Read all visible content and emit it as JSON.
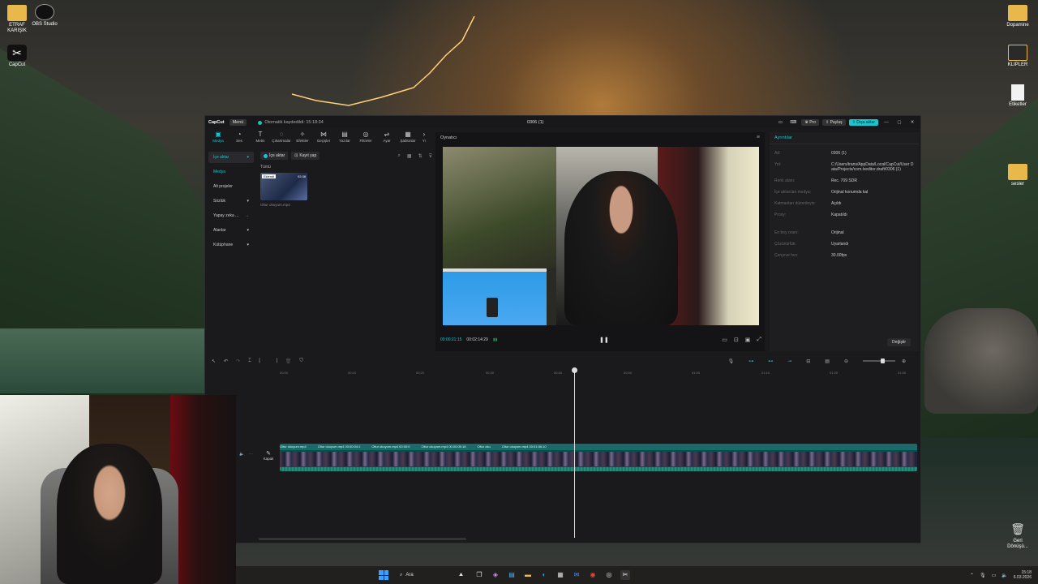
{
  "desktop": {
    "icons_left": [
      {
        "label": "ETRAF\nKARIŞIK",
        "icon": "folder-icon"
      },
      {
        "label": "OBS Studio",
        "icon": "obs-icon"
      },
      {
        "label": "CapCut",
        "icon": "capcut-icon"
      }
    ],
    "icons_right": [
      {
        "label": "Dopamine",
        "icon": "folder-icon"
      },
      {
        "label": "KLIPLER",
        "icon": "folder-icon"
      },
      {
        "label": "Etiketler",
        "icon": "file-icon"
      },
      {
        "label": "sesler",
        "icon": "folder-icon"
      },
      {
        "label": "Geri\nDönüşü...",
        "icon": "recycle-bin-icon"
      }
    ]
  },
  "app": {
    "logo": "CapCut",
    "menu_label": "Menü",
    "saved_text": "Otomatik kaydedildi: 15:18:34",
    "project_title": "0306 (1)",
    "pro_label": "Pro",
    "share_label": "Paylaş",
    "export_label": "Dışa aktar",
    "toolbar": [
      {
        "label": "Medya",
        "icon": "media-icon",
        "active": true
      },
      {
        "label": "Ses",
        "icon": "audio-icon"
      },
      {
        "label": "Metin",
        "icon": "text-icon"
      },
      {
        "label": "Çıkartmalar",
        "icon": "sticker-icon"
      },
      {
        "label": "Efektler",
        "icon": "effects-icon"
      },
      {
        "label": "Geçişler",
        "icon": "transitions-icon"
      },
      {
        "label": "Yazılar",
        "icon": "captions-icon"
      },
      {
        "label": "Filtreler",
        "icon": "filters-icon"
      },
      {
        "label": "Ayar",
        "icon": "adjust-icon"
      },
      {
        "label": "Şablonlar",
        "icon": "templates-icon"
      },
      {
        "label": "Yı",
        "icon": "more-icon"
      }
    ],
    "sidebar": [
      {
        "label": "İçe aktar",
        "selected": true
      },
      {
        "label": "Medya",
        "highlight": true
      },
      {
        "label": "Alt projeler"
      },
      {
        "label": "Sözlük"
      },
      {
        "label": "Yapay zeka ..."
      },
      {
        "label": "Alanlar"
      },
      {
        "label": "Kütüphane"
      }
    ],
    "media": {
      "import_label": "İçe aktar",
      "record_label": "Kayıt yap",
      "all_label": "Tümü",
      "clip": {
        "badge": "Eklendi",
        "duration": "02:38",
        "name": "Oltur okuyum.mp4"
      }
    },
    "player": {
      "label": "Oynatıcı",
      "current_time": "00:00:21:15",
      "total_time": "00:02:14:29"
    },
    "details": {
      "tab": "Ayrıntılar",
      "rows": [
        {
          "key": "Ad:",
          "value": "0306 (1)"
        },
        {
          "key": "Yol:",
          "value": "C:/Users/trans/AppData/Local/CapCut/User Data/Projects/com.lveditor.draft/0306 (1)"
        },
        {
          "key": "Renk alanı:",
          "value": "Rec. 709 SDR"
        },
        {
          "key": "İçe aktarılan medya:",
          "value": "Orijinal konumda kal"
        },
        {
          "key": "Katmanları düzenleyin:",
          "value": "Açıldı"
        },
        {
          "key": "Proxy:",
          "value": "Kapatıldı"
        },
        {
          "key": "En boy oranı:",
          "value": "Orijinal"
        },
        {
          "key": "Çözünürlük:",
          "value": "Uyarlandı"
        },
        {
          "key": "Çerçeve hızı:",
          "value": "30.00fps"
        }
      ],
      "change_label": "Değiştir"
    },
    "timeline": {
      "ruler": [
        "00:00",
        "00:10",
        "00:20",
        "00:30",
        "00:40",
        "00:50",
        "01:00",
        "01:10",
        "01:20",
        "01:30"
      ],
      "cover_label": "Kapak",
      "clip_labels": [
        "Oltur okuyum.mp4",
        "Oltur okuyum.mp4  00:00:04:1",
        "Oltur okuyum.mp4  00:00:0",
        "Oltur okuyum.mp4  00:00:05:18",
        "Oltur oku",
        "Oltur okuyum.mp4  00:01:56:10"
      ]
    }
  },
  "taskbar": {
    "search_placeholder": "Ara",
    "time": "15:18",
    "date": "6.03.2026"
  },
  "colors": {
    "accent": "#1ac5d0"
  }
}
